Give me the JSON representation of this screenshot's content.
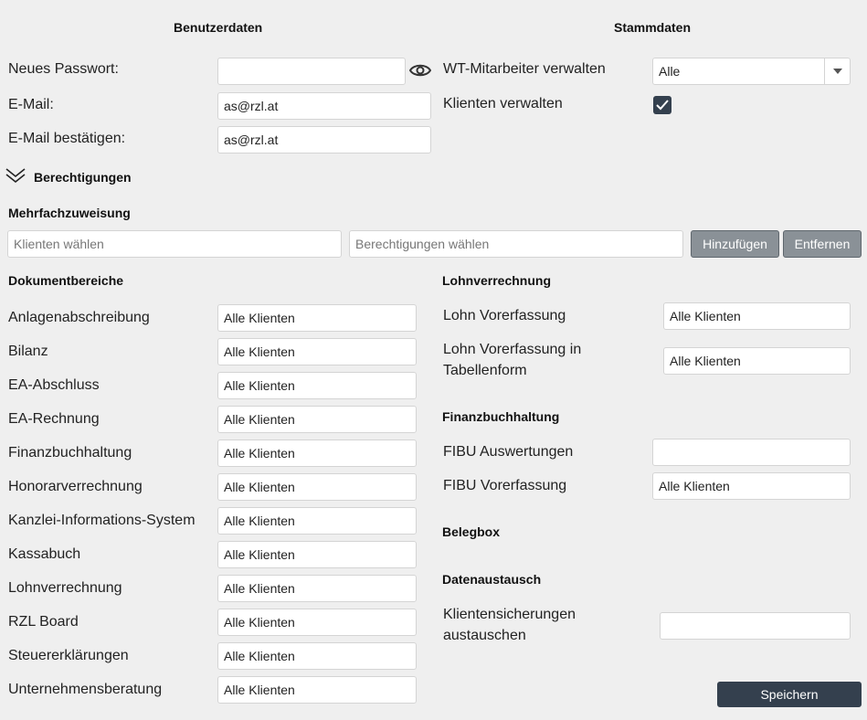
{
  "benutzerdaten": {
    "title": "Benutzerdaten",
    "password_label": "Neues Passwort:",
    "password_value": "",
    "email_label": "E-Mail:",
    "email_value": "as@rzl.at",
    "email_confirm_label": "E-Mail bestätigen:",
    "email_confirm_value": "as@rzl.at"
  },
  "stammdaten": {
    "title": "Stammdaten",
    "wt_label": "WT-Mitarbeiter verwalten",
    "wt_value": "Alle",
    "klienten_label": "Klienten verwalten",
    "klienten_checked": true
  },
  "berechtigungen": {
    "title": "Berechtigungen"
  },
  "mehrfach": {
    "title": "Mehrfachzuweisung",
    "klienten_placeholder": "Klienten wählen",
    "berechtigungen_placeholder": "Berechtigungen wählen",
    "add_label": "Hinzufügen",
    "remove_label": "Entfernen"
  },
  "dokumentbereiche": {
    "title": "Dokumentbereiche",
    "items": [
      {
        "label": "Anlagenabschreibung",
        "value": "Alle Klienten"
      },
      {
        "label": "Bilanz",
        "value": "Alle Klienten"
      },
      {
        "label": "EA-Abschluss",
        "value": "Alle Klienten"
      },
      {
        "label": "EA-Rechnung",
        "value": "Alle Klienten"
      },
      {
        "label": "Finanzbuchhaltung",
        "value": "Alle Klienten"
      },
      {
        "label": "Honorarverrechnung",
        "value": "Alle Klienten"
      },
      {
        "label": "Kanzlei-Informations-System",
        "value": "Alle Klienten"
      },
      {
        "label": "Kassabuch",
        "value": "Alle Klienten"
      },
      {
        "label": "Lohnverrechnung",
        "value": "Alle Klienten"
      },
      {
        "label": "RZL Board",
        "value": "Alle Klienten"
      },
      {
        "label": "Steuererklärungen",
        "value": "Alle Klienten"
      },
      {
        "label": "Unternehmensberatung",
        "value": "Alle Klienten"
      }
    ]
  },
  "lohnverrechnung": {
    "title": "Lohnverrechnung",
    "items": [
      {
        "label": "Lohn Vorerfassung",
        "value": "Alle Klienten"
      },
      {
        "label_line1": "Lohn Vorerfassung in",
        "label_line2": "Tabellenform",
        "value": "Alle Klienten"
      }
    ]
  },
  "finanzbuchhaltung": {
    "title": "Finanzbuchhaltung",
    "items": [
      {
        "label": "FIBU Auswertungen",
        "value": ""
      },
      {
        "label": "FIBU Vorerfassung",
        "value": "Alle Klienten"
      }
    ]
  },
  "belegbox": {
    "title": "Belegbox"
  },
  "datenaustausch": {
    "title": "Datenaustausch",
    "label_line1": "Klientensicherungen",
    "label_line2": "austauschen",
    "value": ""
  },
  "footer": {
    "save_label": "Speichern"
  },
  "icons": {
    "password": "eye-icon",
    "section": "double-chevron-down-icon",
    "select": "caret-down-icon",
    "checkbox": "check-icon"
  },
  "colors": {
    "background": "#efefef",
    "button_gray": "#8a9197",
    "button_dark": "#34404e",
    "checkbox": "#34404e"
  }
}
